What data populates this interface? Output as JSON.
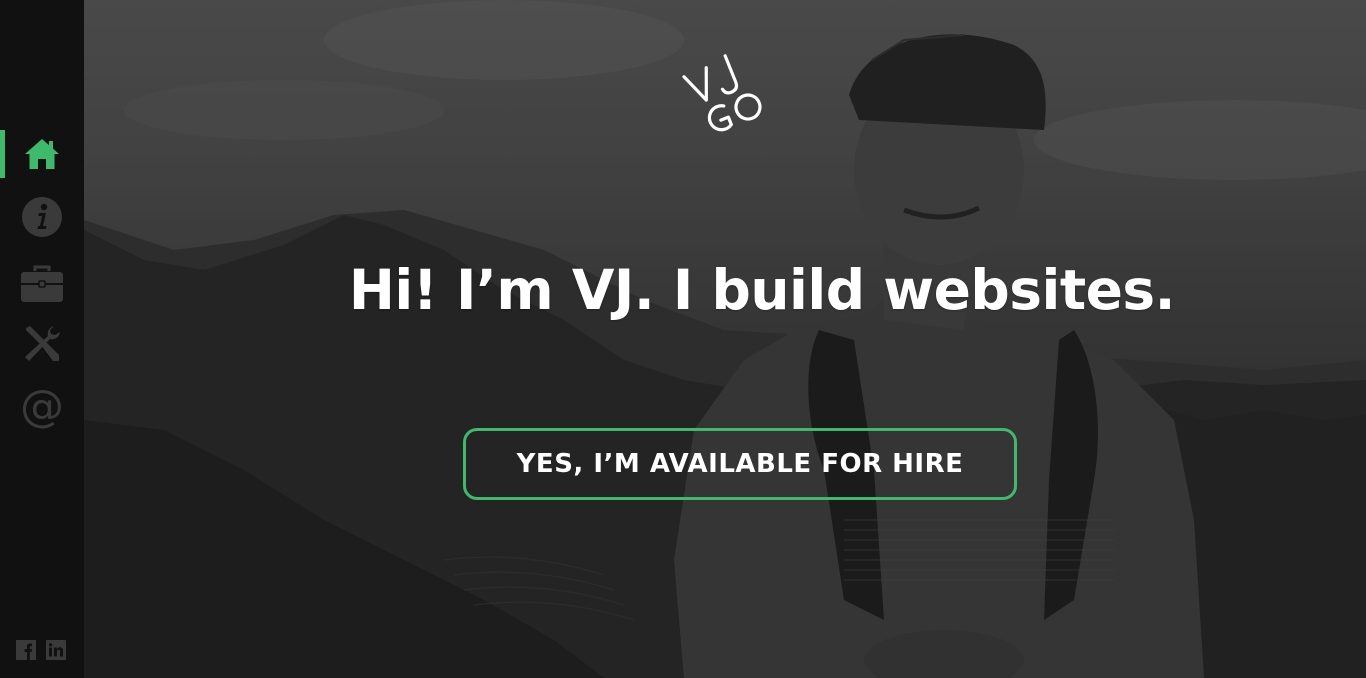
{
  "colors": {
    "accent": "#3dbb6b",
    "sidebar_bg": "#111111",
    "icon_inactive": "#3a3a3a",
    "text": "#ffffff"
  },
  "sidebar": {
    "items": [
      {
        "id": "home",
        "icon": "home-icon",
        "active": true
      },
      {
        "id": "about",
        "icon": "info-icon",
        "active": false
      },
      {
        "id": "portfolio",
        "icon": "briefcase-icon",
        "active": false
      },
      {
        "id": "skills",
        "icon": "tools-icon",
        "active": false
      },
      {
        "id": "contact",
        "icon": "at-icon",
        "active": false
      }
    ],
    "social": [
      {
        "id": "facebook",
        "icon": "facebook-icon",
        "label": "f"
      },
      {
        "id": "linkedin",
        "icon": "linkedin-icon",
        "label": "in"
      }
    ]
  },
  "hero": {
    "logo_letters": {
      "top": "VJ",
      "bottom": "GO"
    },
    "headline": "Hi! I’m VJ. I build websites.",
    "cta_label": "YES, I’M AVAILABLE FOR HIRE"
  }
}
